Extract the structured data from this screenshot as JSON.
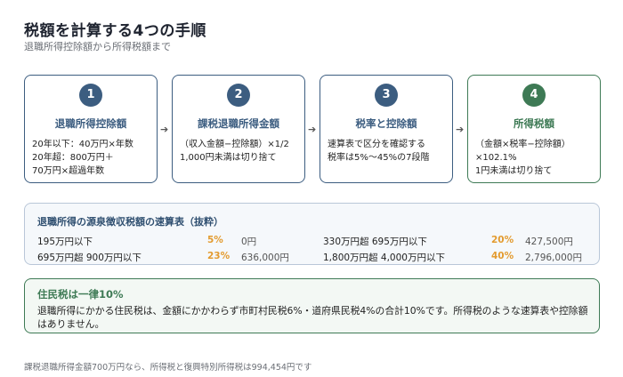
{
  "header": {
    "title": "税額を計算する4つの手順",
    "subtitle": "退職所得控除額から所得税額まで"
  },
  "steps": [
    {
      "num": "1",
      "title": "退職所得控除額",
      "lines": [
        "20年以下：40万円×年数",
        "20年超：800万円＋",
        "70万円×超過年数"
      ]
    },
    {
      "num": "2",
      "title": "課税退職所得金額",
      "lines": [
        "（収入金額−控除額）×1/2",
        "1,000円未満は切り捨て"
      ]
    },
    {
      "num": "3",
      "title": "税率と控除額",
      "lines": [
        "速算表で区分を確認する",
        "税率は5%〜45%の7段階"
      ]
    },
    {
      "num": "4",
      "title": "所得税額",
      "lines": [
        "（金額×税率−控除額）",
        "×102.1%",
        "1円未満は切り捨て"
      ]
    }
  ],
  "arrow": "➔",
  "table": {
    "title": "退職所得の源泉徴収税額の速算表（抜粋）",
    "rows": [
      {
        "range": "195万円以下",
        "rate": "5%",
        "deduction": "0円"
      },
      {
        "range": "695万円超 900万円以下",
        "rate": "23%",
        "deduction": "636,000円"
      },
      {
        "range": "330万円超 695万円以下",
        "rate": "20%",
        "deduction": "427,500円"
      },
      {
        "range": "1,800万円超 4,000万円以下",
        "rate": "40%",
        "deduction": "2,796,000円"
      }
    ]
  },
  "resident": {
    "title": "住民税は一律10%",
    "body": "退職所得にかかる住民税は、金額にかかわらず市町村民税6%・道府県民税4%の合計10%です。所得税のような速算表や控除額はありません。"
  },
  "footer": "課税退職所得金額700万円なら、所得税と復興特別所得税は994,454円です",
  "colors": {
    "primary": "#3c5d80",
    "green": "#3e7a55",
    "rate_accent": "#e39b2f"
  }
}
